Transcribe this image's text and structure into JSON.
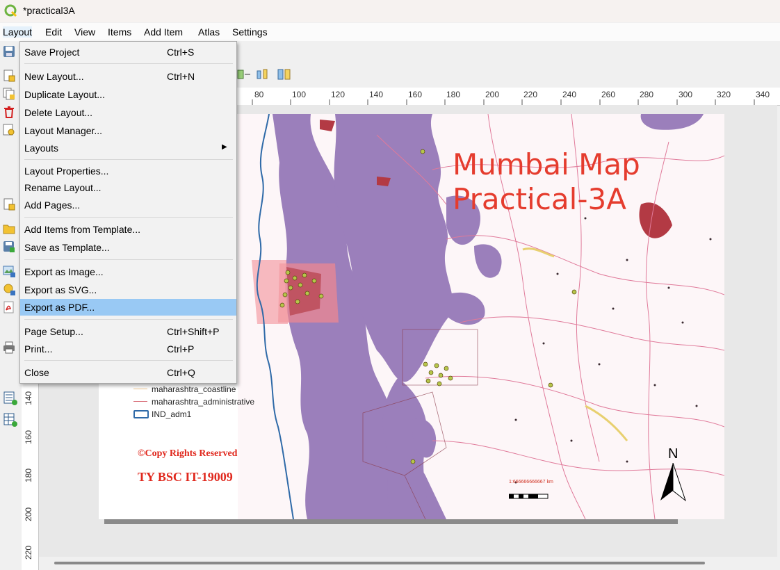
{
  "window": {
    "title": "*practical3A"
  },
  "menubar": [
    "Layout",
    "Edit",
    "View",
    "Items",
    "Add Item",
    "Atlas",
    "Settings"
  ],
  "layout_menu": [
    {
      "label": "Save Project",
      "shortcut": "Ctrl+S",
      "icon": "save-icon"
    },
    {
      "label": "New Layout...",
      "shortcut": "Ctrl+N",
      "icon": "new-layout-icon"
    },
    {
      "label": "Duplicate Layout...",
      "shortcut": "",
      "icon": "duplicate-layout-icon"
    },
    {
      "label": "Delete Layout...",
      "shortcut": "",
      "icon": "delete-icon"
    },
    {
      "label": "Layout Manager...",
      "shortcut": "",
      "icon": "layout-manager-icon"
    },
    {
      "label": "Layouts",
      "shortcut": "",
      "submenu": true
    },
    {
      "label": "Layout Properties...",
      "shortcut": ""
    },
    {
      "label": "Rename Layout...",
      "shortcut": ""
    },
    {
      "label": "Add Pages...",
      "shortcut": "",
      "icon": "add-pages-icon"
    },
    {
      "label": "Add Items from Template...",
      "shortcut": "",
      "icon": "folder-icon"
    },
    {
      "label": "Save as Template...",
      "shortcut": "",
      "icon": "save-template-icon"
    },
    {
      "label": "Export as Image...",
      "shortcut": "",
      "icon": "export-image-icon"
    },
    {
      "label": "Export as SVG...",
      "shortcut": "",
      "icon": "export-svg-icon"
    },
    {
      "label": "Export as PDF...",
      "shortcut": "",
      "icon": "pdf-icon",
      "highlighted": true
    },
    {
      "label": "Page Setup...",
      "shortcut": "Ctrl+Shift+P"
    },
    {
      "label": "Print...",
      "shortcut": "Ctrl+P",
      "icon": "print-icon"
    },
    {
      "label": "Close",
      "shortcut": "Ctrl+Q"
    }
  ],
  "ruler": {
    "horizontal": [
      "80",
      "100",
      "120",
      "140",
      "160",
      "180",
      "200",
      "220",
      "240",
      "260",
      "280",
      "300",
      "320",
      "340"
    ],
    "vertical": [
      "140",
      "160",
      "180",
      "200",
      "220"
    ]
  },
  "map": {
    "title_line1": "Mumbai Map",
    "title_line2": "Practical-3A",
    "legend": [
      {
        "label": "maharashtra_coastline",
        "color": "#f0c48a"
      },
      {
        "label": "maharashtra_administrative",
        "color": "#d9707a"
      },
      {
        "label": "IND_adm1",
        "color": "#2f6aa8"
      }
    ],
    "copyright": "©Copy Rights Reserved",
    "student": "TY BSC IT-19009",
    "north_label": "N",
    "scale_text": "1:666666666667 km"
  },
  "colors": {
    "accent_highlight": "#99c9f4",
    "title_red": "#e53c2e",
    "forest_purple": "#9b7fbb",
    "road_pink": "#e07a9a",
    "urban_red": "#b33a44"
  }
}
